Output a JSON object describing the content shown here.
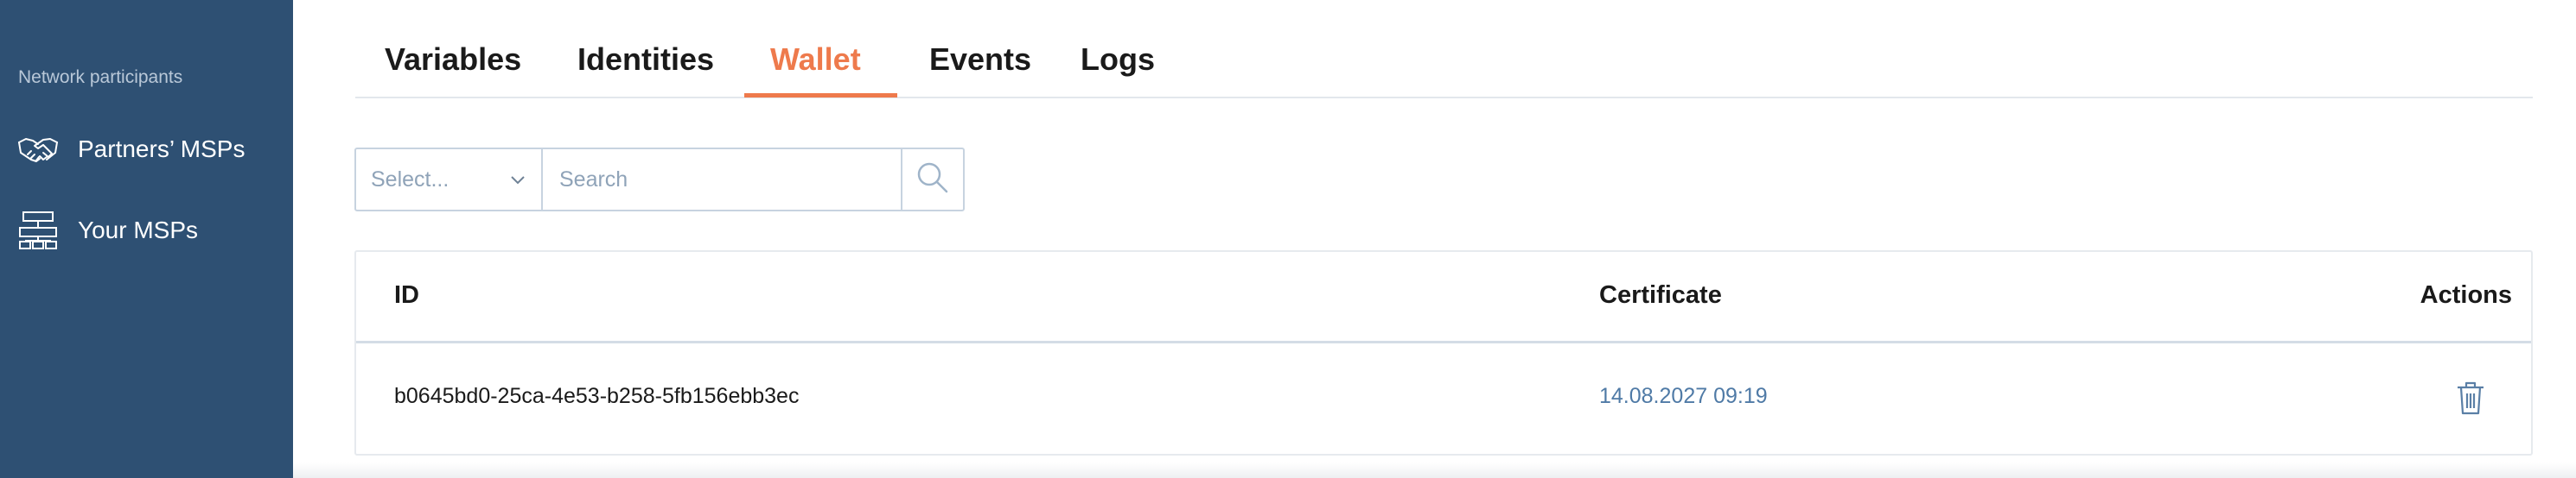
{
  "sidebar": {
    "section_title": "Network participants",
    "items": [
      {
        "label": "Partners’ MSPs",
        "icon": "handshake-icon"
      },
      {
        "label": "Your MSPs",
        "icon": "org-chart-icon"
      }
    ]
  },
  "tabs": [
    {
      "label": "Variables",
      "active": false
    },
    {
      "label": "Identities",
      "active": false
    },
    {
      "label": "Wallet",
      "active": true
    },
    {
      "label": "Events",
      "active": false
    },
    {
      "label": "Logs",
      "active": false
    }
  ],
  "filter": {
    "select_placeholder": "Select...",
    "search_placeholder": "Search"
  },
  "table": {
    "columns": [
      "ID",
      "Certificate",
      "Actions"
    ],
    "rows": [
      {
        "id": "b0645bd0-25ca-4e53-b258-5fb156ebb3ec",
        "certificate": "14.08.2027 09:19",
        "action_icon": "trash-icon"
      }
    ]
  },
  "colors": {
    "sidebar_bg": "#2e5073",
    "accent": "#ee7a4c",
    "link": "#4f7aa6"
  }
}
